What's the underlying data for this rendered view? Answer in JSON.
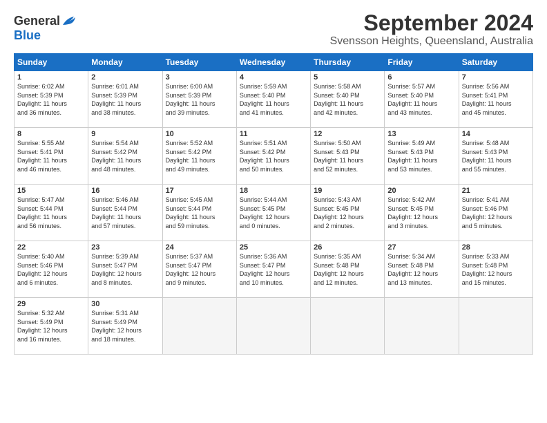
{
  "header": {
    "logo_general": "General",
    "logo_blue": "Blue",
    "month_title": "September 2024",
    "location": "Svensson Heights, Queensland, Australia"
  },
  "weekdays": [
    "Sunday",
    "Monday",
    "Tuesday",
    "Wednesday",
    "Thursday",
    "Friday",
    "Saturday"
  ],
  "weeks": [
    [
      {
        "day": "1",
        "sunrise": "6:02 AM",
        "sunset": "5:39 PM",
        "daylight": "11 hours and 36 minutes."
      },
      {
        "day": "2",
        "sunrise": "6:01 AM",
        "sunset": "5:39 PM",
        "daylight": "11 hours and 38 minutes."
      },
      {
        "day": "3",
        "sunrise": "6:00 AM",
        "sunset": "5:39 PM",
        "daylight": "11 hours and 39 minutes."
      },
      {
        "day": "4",
        "sunrise": "5:59 AM",
        "sunset": "5:40 PM",
        "daylight": "11 hours and 41 minutes."
      },
      {
        "day": "5",
        "sunrise": "5:58 AM",
        "sunset": "5:40 PM",
        "daylight": "11 hours and 42 minutes."
      },
      {
        "day": "6",
        "sunrise": "5:57 AM",
        "sunset": "5:40 PM",
        "daylight": "11 hours and 43 minutes."
      },
      {
        "day": "7",
        "sunrise": "5:56 AM",
        "sunset": "5:41 PM",
        "daylight": "11 hours and 45 minutes."
      }
    ],
    [
      {
        "day": "8",
        "sunrise": "5:55 AM",
        "sunset": "5:41 PM",
        "daylight": "11 hours and 46 minutes."
      },
      {
        "day": "9",
        "sunrise": "5:54 AM",
        "sunset": "5:42 PM",
        "daylight": "11 hours and 48 minutes."
      },
      {
        "day": "10",
        "sunrise": "5:52 AM",
        "sunset": "5:42 PM",
        "daylight": "11 hours and 49 minutes."
      },
      {
        "day": "11",
        "sunrise": "5:51 AM",
        "sunset": "5:42 PM",
        "daylight": "11 hours and 50 minutes."
      },
      {
        "day": "12",
        "sunrise": "5:50 AM",
        "sunset": "5:43 PM",
        "daylight": "11 hours and 52 minutes."
      },
      {
        "day": "13",
        "sunrise": "5:49 AM",
        "sunset": "5:43 PM",
        "daylight": "11 hours and 53 minutes."
      },
      {
        "day": "14",
        "sunrise": "5:48 AM",
        "sunset": "5:43 PM",
        "daylight": "11 hours and 55 minutes."
      }
    ],
    [
      {
        "day": "15",
        "sunrise": "5:47 AM",
        "sunset": "5:44 PM",
        "daylight": "11 hours and 56 minutes."
      },
      {
        "day": "16",
        "sunrise": "5:46 AM",
        "sunset": "5:44 PM",
        "daylight": "11 hours and 57 minutes."
      },
      {
        "day": "17",
        "sunrise": "5:45 AM",
        "sunset": "5:44 PM",
        "daylight": "11 hours and 59 minutes."
      },
      {
        "day": "18",
        "sunrise": "5:44 AM",
        "sunset": "5:45 PM",
        "daylight": "12 hours and 0 minutes."
      },
      {
        "day": "19",
        "sunrise": "5:43 AM",
        "sunset": "5:45 PM",
        "daylight": "12 hours and 2 minutes."
      },
      {
        "day": "20",
        "sunrise": "5:42 AM",
        "sunset": "5:45 PM",
        "daylight": "12 hours and 3 minutes."
      },
      {
        "day": "21",
        "sunrise": "5:41 AM",
        "sunset": "5:46 PM",
        "daylight": "12 hours and 5 minutes."
      }
    ],
    [
      {
        "day": "22",
        "sunrise": "5:40 AM",
        "sunset": "5:46 PM",
        "daylight": "12 hours and 6 minutes."
      },
      {
        "day": "23",
        "sunrise": "5:39 AM",
        "sunset": "5:47 PM",
        "daylight": "12 hours and 8 minutes."
      },
      {
        "day": "24",
        "sunrise": "5:37 AM",
        "sunset": "5:47 PM",
        "daylight": "12 hours and 9 minutes."
      },
      {
        "day": "25",
        "sunrise": "5:36 AM",
        "sunset": "5:47 PM",
        "daylight": "12 hours and 10 minutes."
      },
      {
        "day": "26",
        "sunrise": "5:35 AM",
        "sunset": "5:48 PM",
        "daylight": "12 hours and 12 minutes."
      },
      {
        "day": "27",
        "sunrise": "5:34 AM",
        "sunset": "5:48 PM",
        "daylight": "12 hours and 13 minutes."
      },
      {
        "day": "28",
        "sunrise": "5:33 AM",
        "sunset": "5:48 PM",
        "daylight": "12 hours and 15 minutes."
      }
    ],
    [
      {
        "day": "29",
        "sunrise": "5:32 AM",
        "sunset": "5:49 PM",
        "daylight": "12 hours and 16 minutes."
      },
      {
        "day": "30",
        "sunrise": "5:31 AM",
        "sunset": "5:49 PM",
        "daylight": "12 hours and 18 minutes."
      },
      null,
      null,
      null,
      null,
      null
    ]
  ],
  "labels": {
    "sunrise": "Sunrise:",
    "sunset": "Sunset:",
    "daylight": "Daylight hours"
  }
}
